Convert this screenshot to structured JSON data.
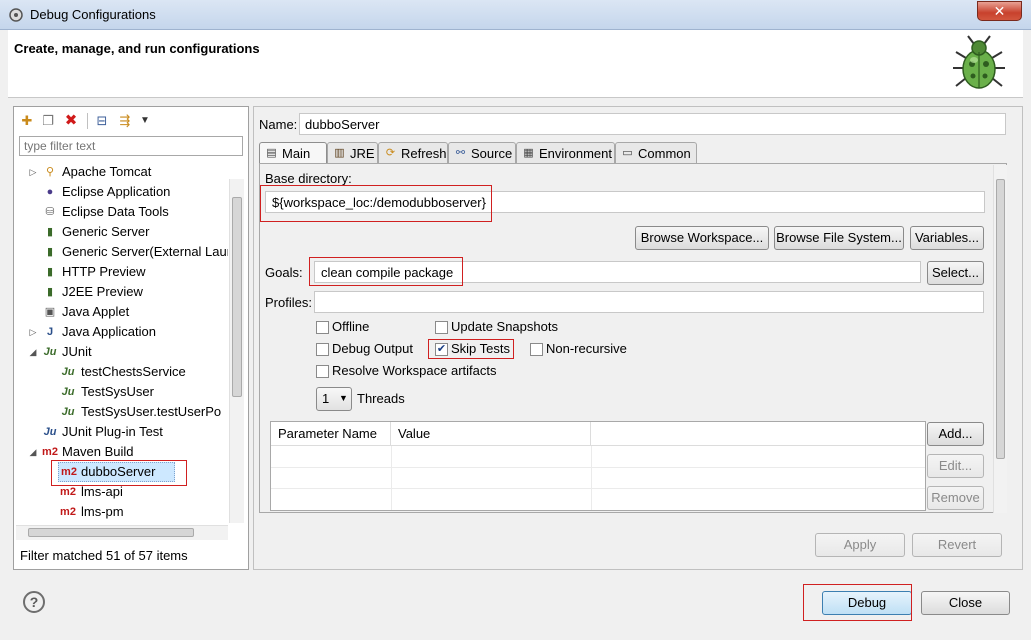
{
  "window": {
    "title": "Debug Configurations",
    "close_glyph": "✕"
  },
  "header": {
    "title": "Create, manage, and run configurations"
  },
  "left": {
    "filter_placeholder": "type filter text",
    "toolbar": [
      "new-config-icon",
      "duplicate-icon",
      "delete-icon",
      "collapse-all-icon",
      "filter-icon",
      "view-menu-icon"
    ],
    "tree": [
      {
        "label": "Apache Tomcat",
        "icon": "tomcat-icon",
        "level": 0,
        "twisty": "▷"
      },
      {
        "label": "Eclipse Application",
        "icon": "eclipse-icon",
        "level": 0,
        "twisty": ""
      },
      {
        "label": "Eclipse Data Tools",
        "icon": "database-icon",
        "level": 0,
        "twisty": ""
      },
      {
        "label": "Generic Server",
        "icon": "server-icon",
        "level": 0,
        "twisty": ""
      },
      {
        "label": "Generic Server(External Laur",
        "icon": "server-icon",
        "level": 0,
        "twisty": ""
      },
      {
        "label": "HTTP Preview",
        "icon": "server-icon",
        "level": 0,
        "twisty": ""
      },
      {
        "label": "J2EE Preview",
        "icon": "server-icon",
        "level": 0,
        "twisty": ""
      },
      {
        "label": "Java Applet",
        "icon": "applet-icon",
        "level": 0,
        "twisty": ""
      },
      {
        "label": "Java Application",
        "icon": "java-app-icon",
        "level": 0,
        "twisty": "▷"
      },
      {
        "label": "JUnit",
        "icon": "junit-icon",
        "level": 0,
        "twisty": "◢"
      },
      {
        "label": "testChestsService",
        "icon": "junit-icon",
        "level": 1,
        "twisty": ""
      },
      {
        "label": "TestSysUser",
        "icon": "junit-icon",
        "level": 1,
        "twisty": ""
      },
      {
        "label": "TestSysUser.testUserPo",
        "icon": "junit-icon",
        "level": 1,
        "twisty": ""
      },
      {
        "label": "JUnit Plug-in Test",
        "icon": "junit-plugin-icon",
        "level": 0,
        "twisty": ""
      },
      {
        "label": "Maven Build",
        "icon": "maven-icon",
        "level": 0,
        "twisty": "◢"
      },
      {
        "label": "dubboServer",
        "icon": "maven-icon",
        "level": 1,
        "twisty": "",
        "selected": true
      },
      {
        "label": "lms-api",
        "icon": "maven-icon",
        "level": 1,
        "twisty": ""
      },
      {
        "label": "lms-pm",
        "icon": "maven-icon",
        "level": 1,
        "twisty": ""
      }
    ],
    "status": "Filter matched 51 of 57 items"
  },
  "right": {
    "name_label": "Name:",
    "name_value": "dubboServer",
    "tabs": [
      {
        "label": "Main",
        "icon": "main-tab-icon",
        "active": true
      },
      {
        "label": "JRE",
        "icon": "jre-icon",
        "active": false
      },
      {
        "label": "Refresh",
        "icon": "refresh-icon",
        "active": false
      },
      {
        "label": "Source",
        "icon": "source-icon",
        "active": false
      },
      {
        "label": "Environment",
        "icon": "environment-icon",
        "active": false
      },
      {
        "label": "Common",
        "icon": "common-icon",
        "active": false
      }
    ],
    "base_dir_label": "Base directory:",
    "base_dir_value": "${workspace_loc:/demodubboserver}",
    "browse_workspace": "Browse Workspace...",
    "browse_fs": "Browse File System...",
    "variables": "Variables...",
    "goals_label": "Goals:",
    "goals_value": "clean compile package",
    "select": "Select...",
    "profiles_label": "Profiles:",
    "profiles_value": "",
    "checks": {
      "offline": {
        "label": "Offline",
        "checked": false
      },
      "update_snapshots": {
        "label": "Update Snapshots",
        "checked": false
      },
      "debug_output": {
        "label": "Debug Output",
        "checked": false
      },
      "skip_tests": {
        "label": "Skip Tests",
        "checked": true
      },
      "non_recursive": {
        "label": "Non-recursive",
        "checked": false
      },
      "resolve_ws": {
        "label": "Resolve Workspace artifacts",
        "checked": false
      }
    },
    "threads_value": "1",
    "threads_label": "Threads",
    "param_headers": [
      "Parameter Name",
      "Value"
    ],
    "add": "Add...",
    "edit": "Edit...",
    "remove": "Remove",
    "apply": "Apply",
    "revert": "Revert"
  },
  "footer": {
    "debug": "Debug",
    "close": "Close",
    "help_glyph": "?"
  },
  "colors": {
    "highlight": "#d02020",
    "selection": "#cde8ff"
  }
}
